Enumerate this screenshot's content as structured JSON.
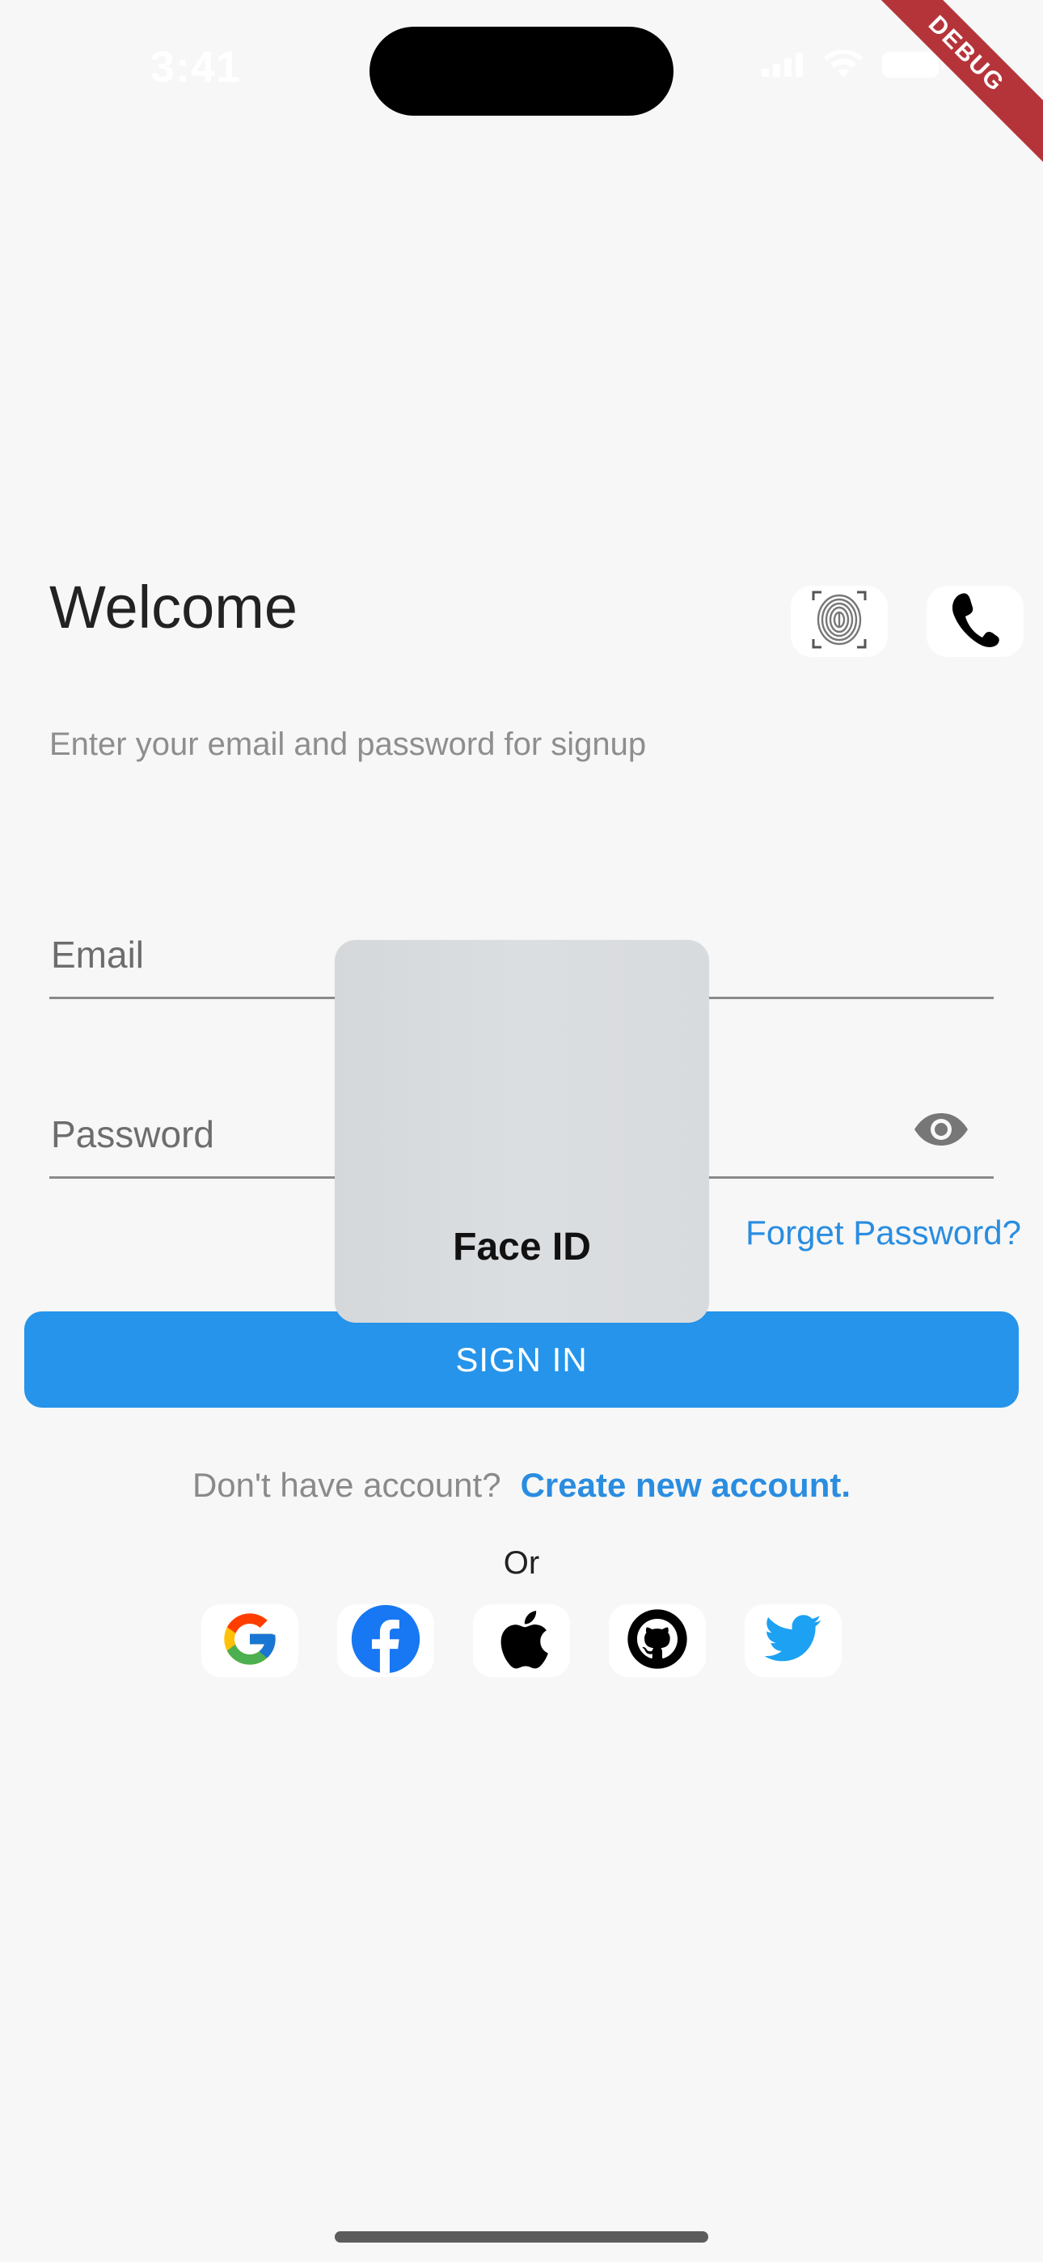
{
  "status_bar": {
    "time": "3:41"
  },
  "debug_banner": "DEBUG",
  "header": {
    "title": "Welcome",
    "subtitle": "Enter your email and password for signup",
    "fingerprint_icon": "fingerprint-icon",
    "phone_icon": "phone-icon"
  },
  "form": {
    "email_placeholder": "Email",
    "email_value": "",
    "password_placeholder": "Password",
    "password_value": "",
    "forgot_label": "Forget Password?",
    "signin_label": "SIGN IN"
  },
  "account": {
    "question": "Don't have account?",
    "create_label": "Create new account."
  },
  "or_label": "Or",
  "social": [
    {
      "name": "google-icon"
    },
    {
      "name": "facebook-icon"
    },
    {
      "name": "apple-icon"
    },
    {
      "name": "github-icon"
    },
    {
      "name": "twitter-icon"
    }
  ],
  "face_id": {
    "label": "Face ID"
  },
  "colors": {
    "accent": "#2594EA",
    "link": "#2A8DE0",
    "background": "#F7F7F7",
    "debug_ribbon": "#B5343A"
  }
}
